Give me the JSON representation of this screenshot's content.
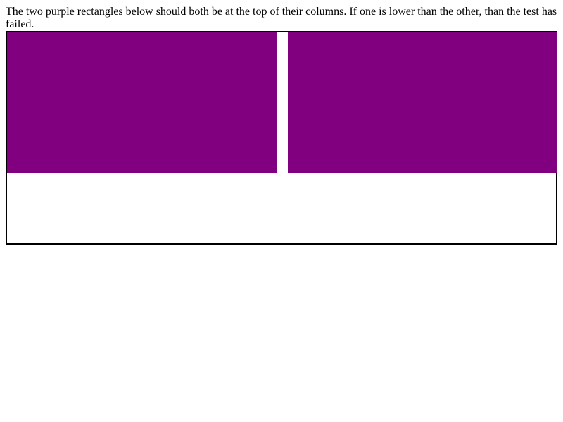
{
  "instruction": {
    "text": "The two purple rectangles below should both be at the top of their columns. If one is lower than the other, than the test has failed."
  },
  "colors": {
    "rectangle": "#800080",
    "border": "#000000",
    "background": "#ffffff"
  },
  "test": {
    "columns": [
      {
        "name": "left-column"
      },
      {
        "name": "right-column"
      }
    ]
  }
}
